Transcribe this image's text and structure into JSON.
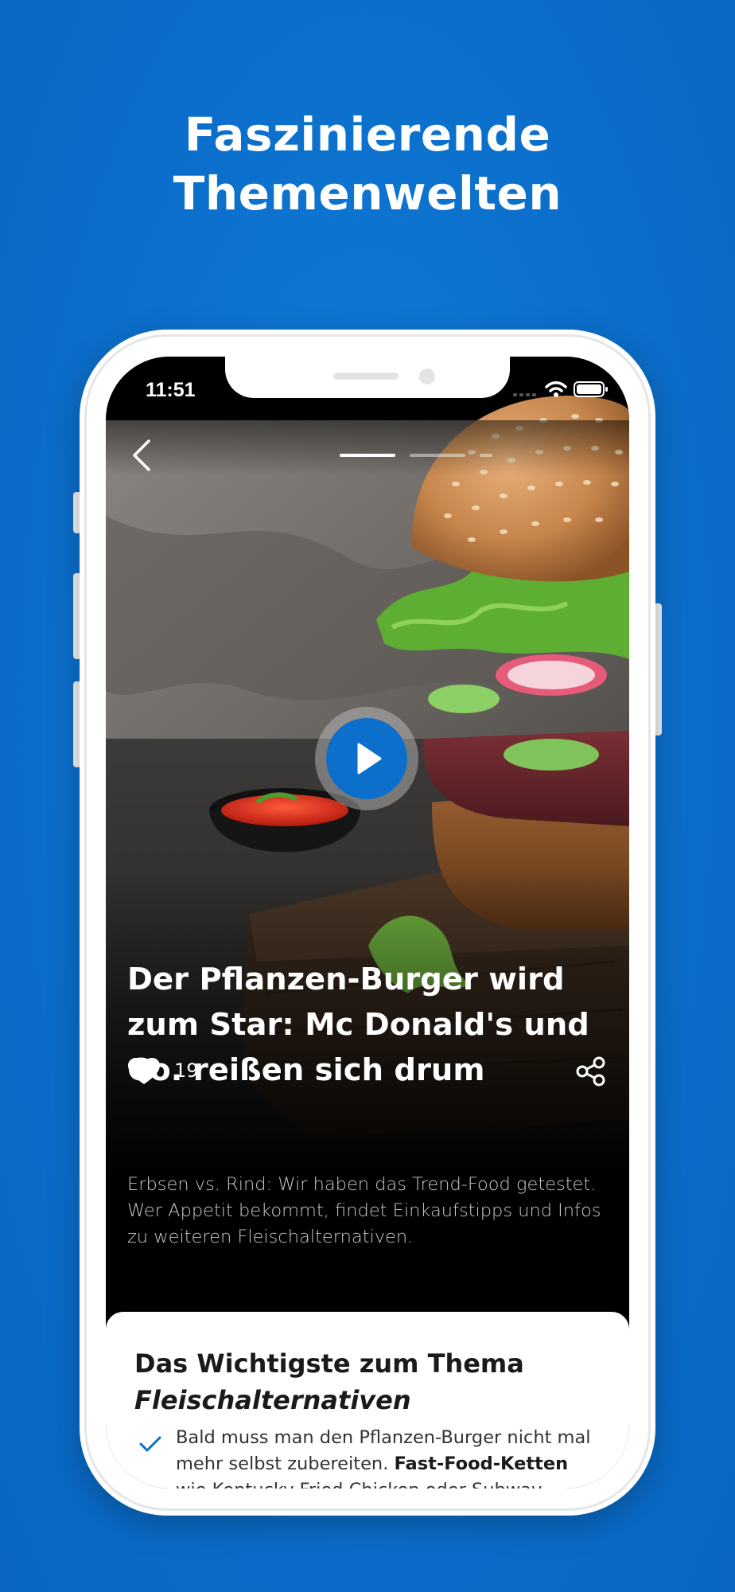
{
  "promo": {
    "headline_line1": "Faszinierende",
    "headline_line2": "Themenwelten"
  },
  "status_bar": {
    "time": "11:51"
  },
  "story": {
    "segments": 3,
    "active_segment": 1
  },
  "article": {
    "title": "Der Pflanzen-Burger wird zum Star: Mc Donald's und Co. reißen sich drum",
    "likes": "19",
    "teaser": "Erbsen vs. Rind: Wir haben das Trend-Food getestet. Wer Appetit bekommt, findet Einkaufstipps und Infos zu weiteren Fleischalternativen."
  },
  "key_points": {
    "title": "Das Wichtigste zum Thema",
    "topic": "Fleischalternativen",
    "point1_text": "Bald muss man den Pflanzen-Burger nicht mal mehr selbst zubereiten.",
    "point1_bold": "Fast-Food-Ketten",
    "point1_rest": "wie Kentucky Fried Chicken oder Subway hatten die"
  },
  "icons": {
    "back": "chevron-left-icon",
    "play": "play-icon",
    "like": "heart-icon",
    "share": "share-icon",
    "check": "checkmark-icon",
    "wifi": "wifi-icon",
    "battery": "battery-icon",
    "signal": "signal-icon"
  },
  "colors": {
    "brand_blue": "#0b6fcb",
    "background": "#0b6fcb",
    "card_bg": "#ffffff",
    "text_light": "#ffffff"
  }
}
